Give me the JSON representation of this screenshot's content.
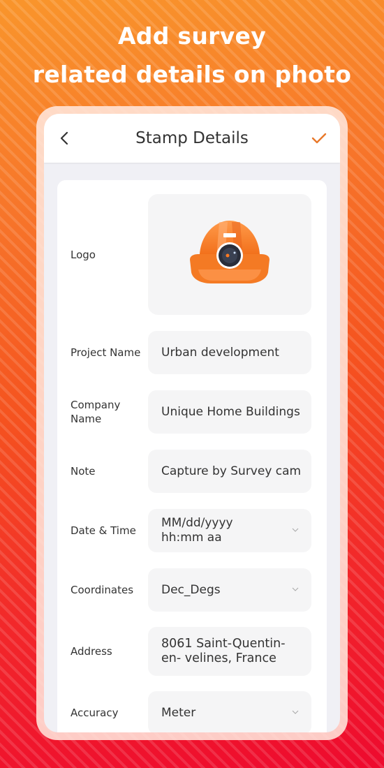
{
  "headline": {
    "line1": "Add survey",
    "line2": "related details on photo"
  },
  "appbar": {
    "title": "Stamp Details",
    "back_icon": "chevron-left-icon",
    "confirm_icon": "check-icon"
  },
  "colors": {
    "accent": "#e8782a",
    "bg_top": "#f9952b",
    "bg_bottom": "#ee0a2e",
    "field_bg": "#f5f5f6"
  },
  "form": {
    "logo": {
      "label": "Logo",
      "image": "survey-helmet-camera-logo"
    },
    "project_name": {
      "label": "Project Name",
      "value": "Urban development"
    },
    "company_name": {
      "label": "Company Name",
      "value": "Unique Home Buildings"
    },
    "note": {
      "label": "Note",
      "value": "Capture by Survey cam"
    },
    "date_time": {
      "label": "Date & Time",
      "value": "MM/dd/yyyy hh:mm aa"
    },
    "coordinates": {
      "label": "Coordinates",
      "value": "Dec_Degs"
    },
    "address": {
      "label": "Address",
      "value": "8061 Saint-Quentin-en- velines, France"
    },
    "accuracy": {
      "label": "Accuracy",
      "value": "Meter"
    }
  }
}
